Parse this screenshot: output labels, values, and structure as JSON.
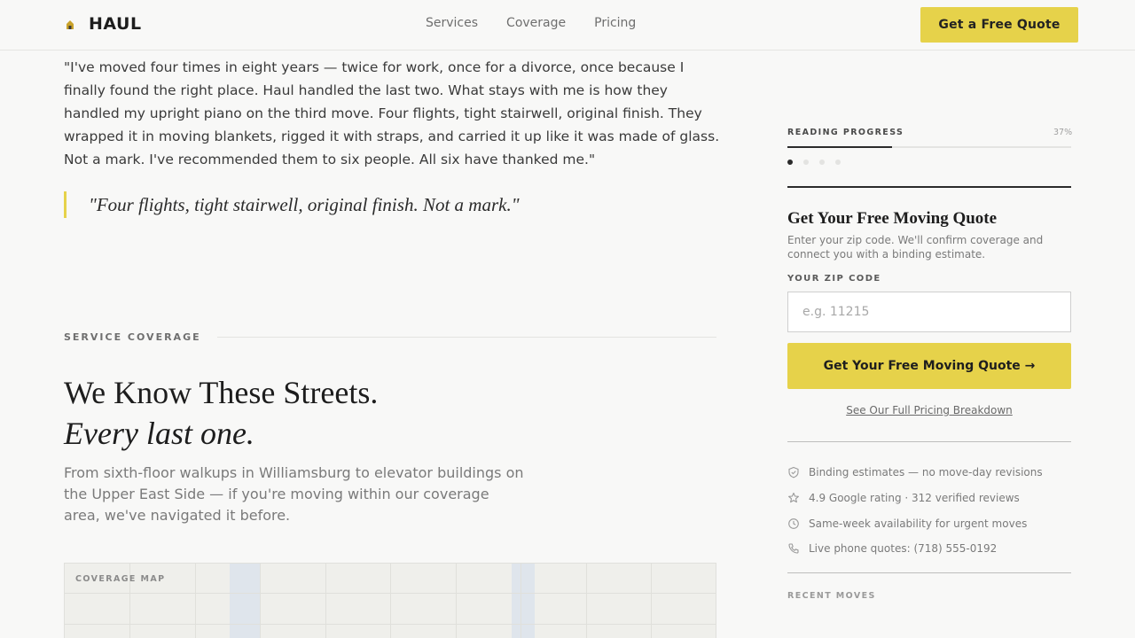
{
  "header": {
    "brand": "HAUL",
    "nav": [
      "Services",
      "Coverage",
      "Pricing"
    ],
    "cta_label": "Get a Free Quote"
  },
  "testimonial": {
    "body": "\"I've moved four times in eight years — twice for work, once for a divorce, once because I finally found the right place. Haul handled the last two. What stays with me is how they handled my upright piano on the third move. Four flights, tight stairwell, original finish. They wrapped it in moving blankets, rigged it with straps, and carried it up like it was made of glass. Not a mark. I've recommended them to six people. All six have thanked me.\"",
    "pullquote": "\"Four flights, tight stairwell, original finish. Not a mark.\""
  },
  "coverage": {
    "eyebrow": "SERVICE COVERAGE",
    "heading_line1": "We Know These Streets.",
    "heading_line2": "Every last one.",
    "lede": "From sixth-floor walkups in Williamsburg to elevator buildings on the Upper East Side — if you're moving within our coverage area, we've navigated it before.",
    "map_label": "COVERAGE MAP"
  },
  "sidebar": {
    "reading_progress_label": "READING PROGRESS",
    "reading_progress_pct": "37%",
    "reading_progress_value": 0.37,
    "section_dots": {
      "count": 4,
      "active_index": 0
    },
    "form_title": "Get Your Free Moving Quote",
    "form_subtitle": "Enter your zip code. We'll confirm coverage and connect you with a binding estimate.",
    "zip_label": "YOUR ZIP CODE",
    "zip_placeholder": "e.g. 11215",
    "zip_value": "",
    "submit_label": "Get Your Free Moving Quote →",
    "pricing_link": "See Our Full Pricing Breakdown",
    "trust_items": [
      {
        "icon": "shield-icon",
        "text": "Binding estimates — no move-day revisions"
      },
      {
        "icon": "star-icon",
        "text": "4.9 Google rating · 312 verified reviews"
      },
      {
        "icon": "clock-icon",
        "text": "Same-week availability for urgent moves"
      },
      {
        "icon": "phone-icon",
        "text": "Live phone quotes: (718) 555-0192"
      }
    ],
    "recent_moves_label": "RECENT MOVES"
  },
  "colors": {
    "accent": "#e6d24a",
    "background": "#f8f8f7",
    "text": "#2b2b2b"
  }
}
